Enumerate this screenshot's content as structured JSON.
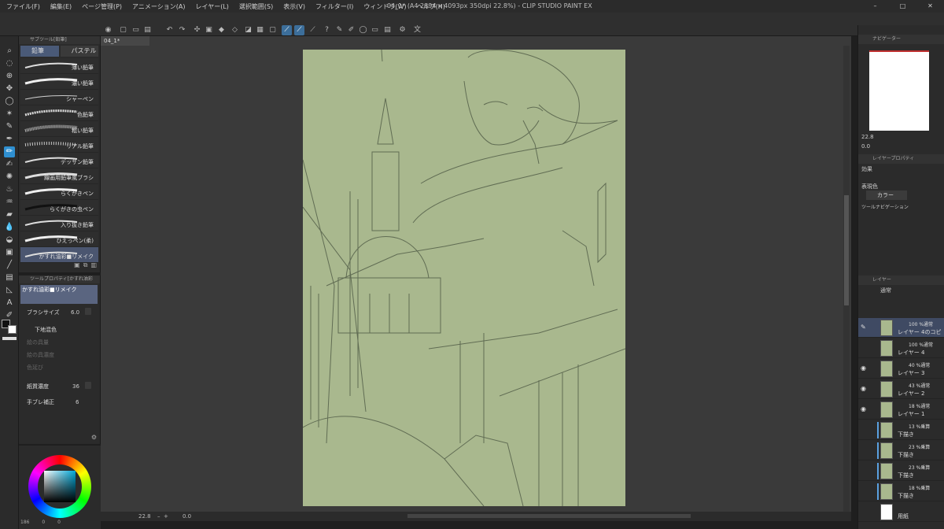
{
  "titlebar": {
    "menu": [
      "ファイル(F)",
      "編集(E)",
      "ページ管理(P)",
      "アニメーション(A)",
      "レイヤー(L)",
      "選択範囲(S)",
      "表示(V)",
      "フィルター(I)",
      "ウィンドウ(W)",
      "ヘルプ(H)"
    ],
    "title": "04_1* (A4 2894 x 4093px 350dpi 22.8%) - CLIP STUDIO PAINT EX"
  },
  "subtool": {
    "header": "サブツール[鉛筆]",
    "tabs": [
      "鉛筆",
      "パステル"
    ],
    "brushes": [
      "薄い鉛筆",
      "濃い鉛筆",
      "シャーペン",
      "色鉛筆",
      "粗い鉛筆",
      "リアル鉛筆",
      "デッサン鉛筆",
      "線画用鉛筆風ブラシ",
      "らくがきペン",
      "らくがきの虫ペン",
      "入り抜き鉛筆",
      "ひえっペン(柔)",
      "かすれ油彩■リメイク"
    ]
  },
  "toolprop": {
    "header": "ツールプロパティ[かすれ油彩",
    "name": "かすれ油彩■リメイク",
    "brush_size_label": "ブラシサイズ",
    "brush_size": "6.0",
    "ground_label": "下地混色",
    "paint_amount": "絵の具量",
    "paint_density": "絵の具濃度",
    "blur": "色延び",
    "paper_label": "紙質濃度",
    "paper_val": "36",
    "stab_label": "手ブレ補正",
    "stab_val": "6"
  },
  "canvas": {
    "doctab": "04_1*"
  },
  "status": {
    "zoom": "22.8",
    "angle": "0.0"
  },
  "right": {
    "navigator": "ナビゲーター",
    "nav_zoom": "22.8",
    "nav_angle": "0.0",
    "layerprop": "レイヤープロパティ",
    "effect": "効果",
    "expr_color_label": "表現色",
    "expr_color": "カラー",
    "toolnav": "ツールナビゲーション",
    "layers_tab": "レイヤー",
    "blend": "通常"
  },
  "layers": [
    {
      "pct": "100 %通常",
      "name": "レイヤー 4のコピー"
    },
    {
      "pct": "100 %通常",
      "name": "レイヤー 4"
    },
    {
      "pct": "40 %通常",
      "name": "レイヤー 3"
    },
    {
      "pct": "43 %通常",
      "name": "レイヤー 2"
    },
    {
      "pct": "18 %通常",
      "name": "レイヤー 1"
    },
    {
      "pct": "13 %乗算",
      "name": "下描き"
    },
    {
      "pct": "23 %乗算",
      "name": "下描き"
    },
    {
      "pct": "23 %乗算",
      "name": "下描き"
    },
    {
      "pct": "18 %乗算",
      "name": "下描き"
    },
    {
      "pct": "",
      "name": "用紙"
    }
  ],
  "color": {
    "r": "186",
    "g": "0",
    "b": "0"
  }
}
